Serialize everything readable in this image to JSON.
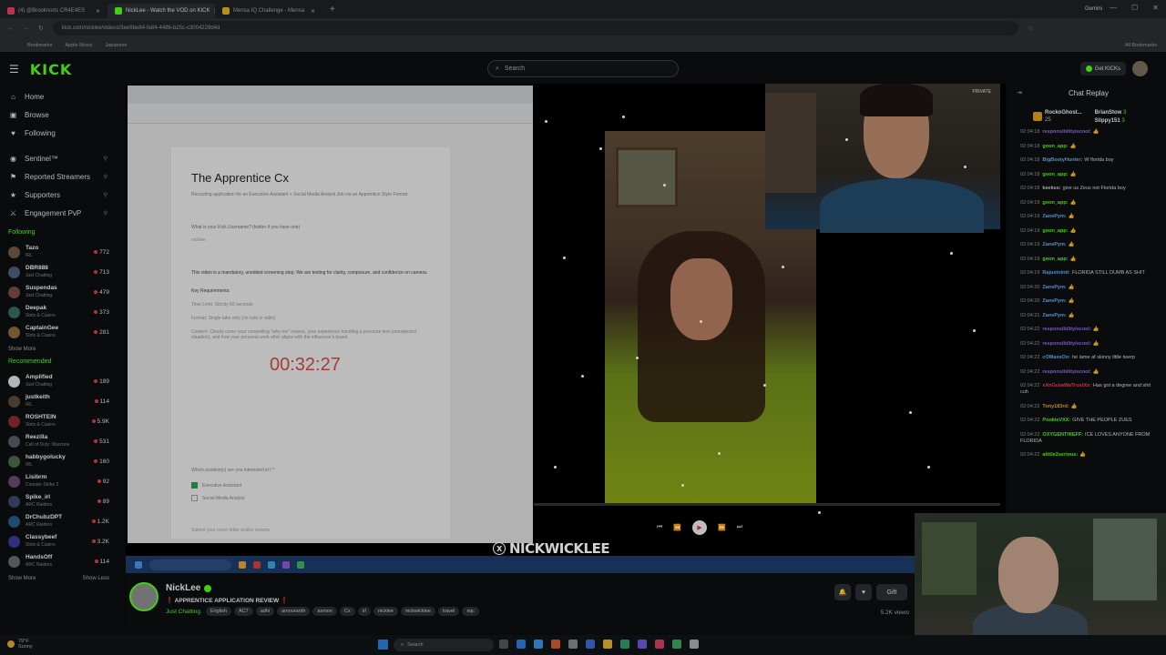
{
  "browser": {
    "tabs": [
      {
        "label": "(4) @Brooknorts CR4E4ES",
        "active": false,
        "color": "#e4405f"
      },
      {
        "label": "NickLee - Watch the VOD on KICK",
        "active": true,
        "color": "#53fc18"
      },
      {
        "label": "Mensa IQ Challenge - Mensa",
        "active": false,
        "color": "#e0b020"
      }
    ],
    "new_tab_icon": "+",
    "gemini_label": "Gemini",
    "url": "kick.com/nicklee/videos/3ee9be84-fe84-4486-b25c-c3004229d4d",
    "bookmarks": [
      "Bookmarks",
      "Apple Music",
      "Japanese"
    ],
    "all_bookmarks": "All Bookmarks"
  },
  "header": {
    "logo": "KICK",
    "search_placeholder": "Search",
    "get_kicks": "Get KICKs"
  },
  "sidebar": {
    "nav": [
      {
        "label": "Home",
        "icon": "home-icon",
        "glyph": "⌂"
      },
      {
        "label": "Browse",
        "icon": "browse-icon",
        "glyph": "▣"
      },
      {
        "label": "Following",
        "icon": "heart-icon",
        "glyph": "♥"
      }
    ],
    "extras": [
      {
        "label": "Sentinel™",
        "icon": "sentinel-icon",
        "glyph": "◉"
      },
      {
        "label": "Reported Streamers",
        "icon": "flag-icon",
        "glyph": "⚑"
      },
      {
        "label": "Supporters",
        "icon": "star-icon",
        "glyph": "★"
      },
      {
        "label": "Engagement PvP",
        "icon": "swords-icon",
        "glyph": "⚔"
      }
    ],
    "following_title": "Following",
    "following": [
      {
        "name": "Tazo",
        "game": "IRL",
        "viewers": "772",
        "color": "#6d5a4a"
      },
      {
        "name": "DBR888",
        "game": "Just Chatting",
        "viewers": "713",
        "color": "#4a5e7a"
      },
      {
        "name": "Suspendas",
        "game": "Just Chatting",
        "viewers": "479",
        "color": "#7a4a4a"
      },
      {
        "name": "Deepak",
        "game": "Slots & Casino",
        "viewers": "373",
        "color": "#3a6a5a"
      },
      {
        "name": "CaptainGee",
        "game": "Slots & Casino",
        "viewers": "281",
        "color": "#8a6a3a"
      }
    ],
    "show_more": "Show More",
    "recommended_title": "Recommended",
    "recommended": [
      {
        "name": "Amplified",
        "game": "Just Chatting",
        "viewers": "189",
        "color": "#dddddd"
      },
      {
        "name": "justkeith",
        "game": "IRL",
        "viewers": "114",
        "color": "#5a4a3a"
      },
      {
        "name": "ROSHTEIN",
        "game": "Slots & Casino",
        "viewers": "5.9K",
        "color": "#8a2a2a"
      },
      {
        "name": "Reezilla",
        "game": "Call of Duty: Warzone",
        "viewers": "531",
        "color": "#5a5a6a"
      },
      {
        "name": "habbygolucky",
        "game": "IRL",
        "viewers": "160",
        "color": "#4a6a4a"
      },
      {
        "name": "Lisibrm",
        "game": "Counter-Strike 2",
        "viewers": "92",
        "color": "#6a4a6a"
      },
      {
        "name": "Spike_irl",
        "game": "ARC Raiders",
        "viewers": "89",
        "color": "#3a4a6a"
      },
      {
        "name": "DrChubzDPT",
        "game": "ARC Raiders",
        "viewers": "1.2K",
        "color": "#2a5a8a"
      },
      {
        "name": "Classybeef",
        "game": "Slots & Casino",
        "viewers": "3.2K",
        "color": "#3a3a9a"
      },
      {
        "name": "HandsOff",
        "game": "ARC Raiders",
        "viewers": "114",
        "color": "#6a6a6a"
      }
    ],
    "show_more_2": "Show More",
    "show_less": "Show Less"
  },
  "player": {
    "doc": {
      "title": "The Apprentice Cx",
      "subtitle": "Recruiting application for an Executive Assistant + Social Media Analyst Job via an Apprentice Style Format",
      "question": "What is your Kick Username? (twitter if you have one)",
      "answer": "nicklee",
      "mandatory": "This video is a mandatory, unedited screening step. We are testing for clarity, composure, and confidence on camera.",
      "key_req": "Key Requirements:",
      "time_limit": "Time Limit: Strictly 60 seconds",
      "format": "Format: Single take only (no cuts or edits)",
      "content": "Content: Clearly cover your compelling \"why me\" reason, your experience handling a pressure test (unexpected situation), and how your personal work ethic aligns with the influencer's brand.",
      "timer": "00:32:27",
      "position_q": "Which position(s) are you interested in? *",
      "option1": "Executive Assistant",
      "option2": "Social Media Analyst",
      "footer": "Submit your cover letter and/or resume"
    },
    "cam2_tag": "PRIVATE",
    "streamer_overlay": "NICKWICKLEE",
    "controls": [
      "⏮",
      "⏪",
      "▶",
      "⏩",
      "⏭"
    ]
  },
  "chat": {
    "title": "Chat Replay",
    "gifters": [
      {
        "name": "RockoGhost...",
        "count": "25"
      },
      {
        "name": "BrianStow",
        "count": "3"
      },
      {
        "name": "Slippy151",
        "count": "3"
      }
    ],
    "messages": [
      {
        "time": "02:04:18",
        "user": "responsibilityiscool:",
        "color": "#9b6bf0",
        "text": "👍"
      },
      {
        "time": "02:04:18",
        "user": "goon_app:",
        "color": "#53fc18",
        "text": "👍"
      },
      {
        "time": "02:04:18",
        "user": "BigBootyHunter:",
        "color": "#6ab0f0",
        "text": "W florida boy"
      },
      {
        "time": "02:04:18",
        "user": "goon_app:",
        "color": "#53fc18",
        "text": "👍"
      },
      {
        "time": "02:04:18",
        "user": "keekss:",
        "color": "#cccccc",
        "text": "give us Zeus not Florida boy"
      },
      {
        "time": "02:04:19",
        "user": "goon_app:",
        "color": "#53fc18",
        "text": "👍"
      },
      {
        "time": "02:04:19",
        "user": "ZanePym:",
        "color": "#6ab0f0",
        "text": "👍"
      },
      {
        "time": "02:04:19",
        "user": "goon_app:",
        "color": "#53fc18",
        "text": "👍"
      },
      {
        "time": "02:04:19",
        "user": "ZanePym:",
        "color": "#6ab0f0",
        "text": "👍"
      },
      {
        "time": "02:04:19",
        "user": "goon_app:",
        "color": "#53fc18",
        "text": "👍"
      },
      {
        "time": "02:04:19",
        "user": "Rajustnintt:",
        "color": "#6ab0f0",
        "text": "FLORIDA STILL DUMB AS SHIT"
      },
      {
        "time": "02:04:20",
        "user": "ZanePym:",
        "color": "#6ab0f0",
        "text": "👍"
      },
      {
        "time": "02:04:20",
        "user": "ZanePym:",
        "color": "#6ab0f0",
        "text": "👍"
      },
      {
        "time": "02:04:21",
        "user": "ZanePym:",
        "color": "#6ab0f0",
        "text": "👍"
      },
      {
        "time": "02:04:22",
        "user": "responsibilityiscool:",
        "color": "#9b6bf0",
        "text": "👍"
      },
      {
        "time": "02:04:22",
        "user": "responsibilityiscool:",
        "color": "#9b6bf0",
        "text": "👍"
      },
      {
        "time": "02:04:22",
        "user": "cOMaxeOo:",
        "color": "#6ab0f0",
        "text": "he lame af skinny little twerp"
      },
      {
        "time": "02:04:22",
        "user": "responsibilityiscool:",
        "color": "#9b6bf0",
        "text": "👍"
      },
      {
        "time": "02:04:22",
        "user": "xXnGuiwWaTrustXx:",
        "color": "#f0405a",
        "text": "Has got a degree and shit cuh"
      },
      {
        "time": "02:04:22",
        "user": "Tony183rd:",
        "color": "#f0a030",
        "text": "👍"
      },
      {
        "time": "02:04:22",
        "user": "PookieVXX:",
        "color": "#53fc18",
        "text": "GIVE THE PEOPLE ZUES"
      },
      {
        "time": "02:04:22",
        "user": "OXYGENTHIEFF:",
        "color": "#53fc18",
        "text": "ICE LOVES ANYONE FROM FLORIDA"
      },
      {
        "time": "02:04:22",
        "user": "alittle2serious:",
        "color": "#53fc18",
        "text": "👍"
      }
    ]
  },
  "streamer": {
    "name": "NickLee",
    "title": "❗ APPRENTICE APPLICATION REVIEW ❗",
    "category": "Just Chatting",
    "tags": [
      "English",
      "AC7",
      "adhi",
      "amouranth",
      "asmon",
      "Cx",
      "irl",
      "nicklee",
      "nickwicklee",
      "travel",
      "xqc"
    ],
    "gift_label": "Gift",
    "views": "5.2K views"
  },
  "taskbar": {
    "temp": "79°F",
    "weather": "Sunny",
    "search": "Search"
  }
}
